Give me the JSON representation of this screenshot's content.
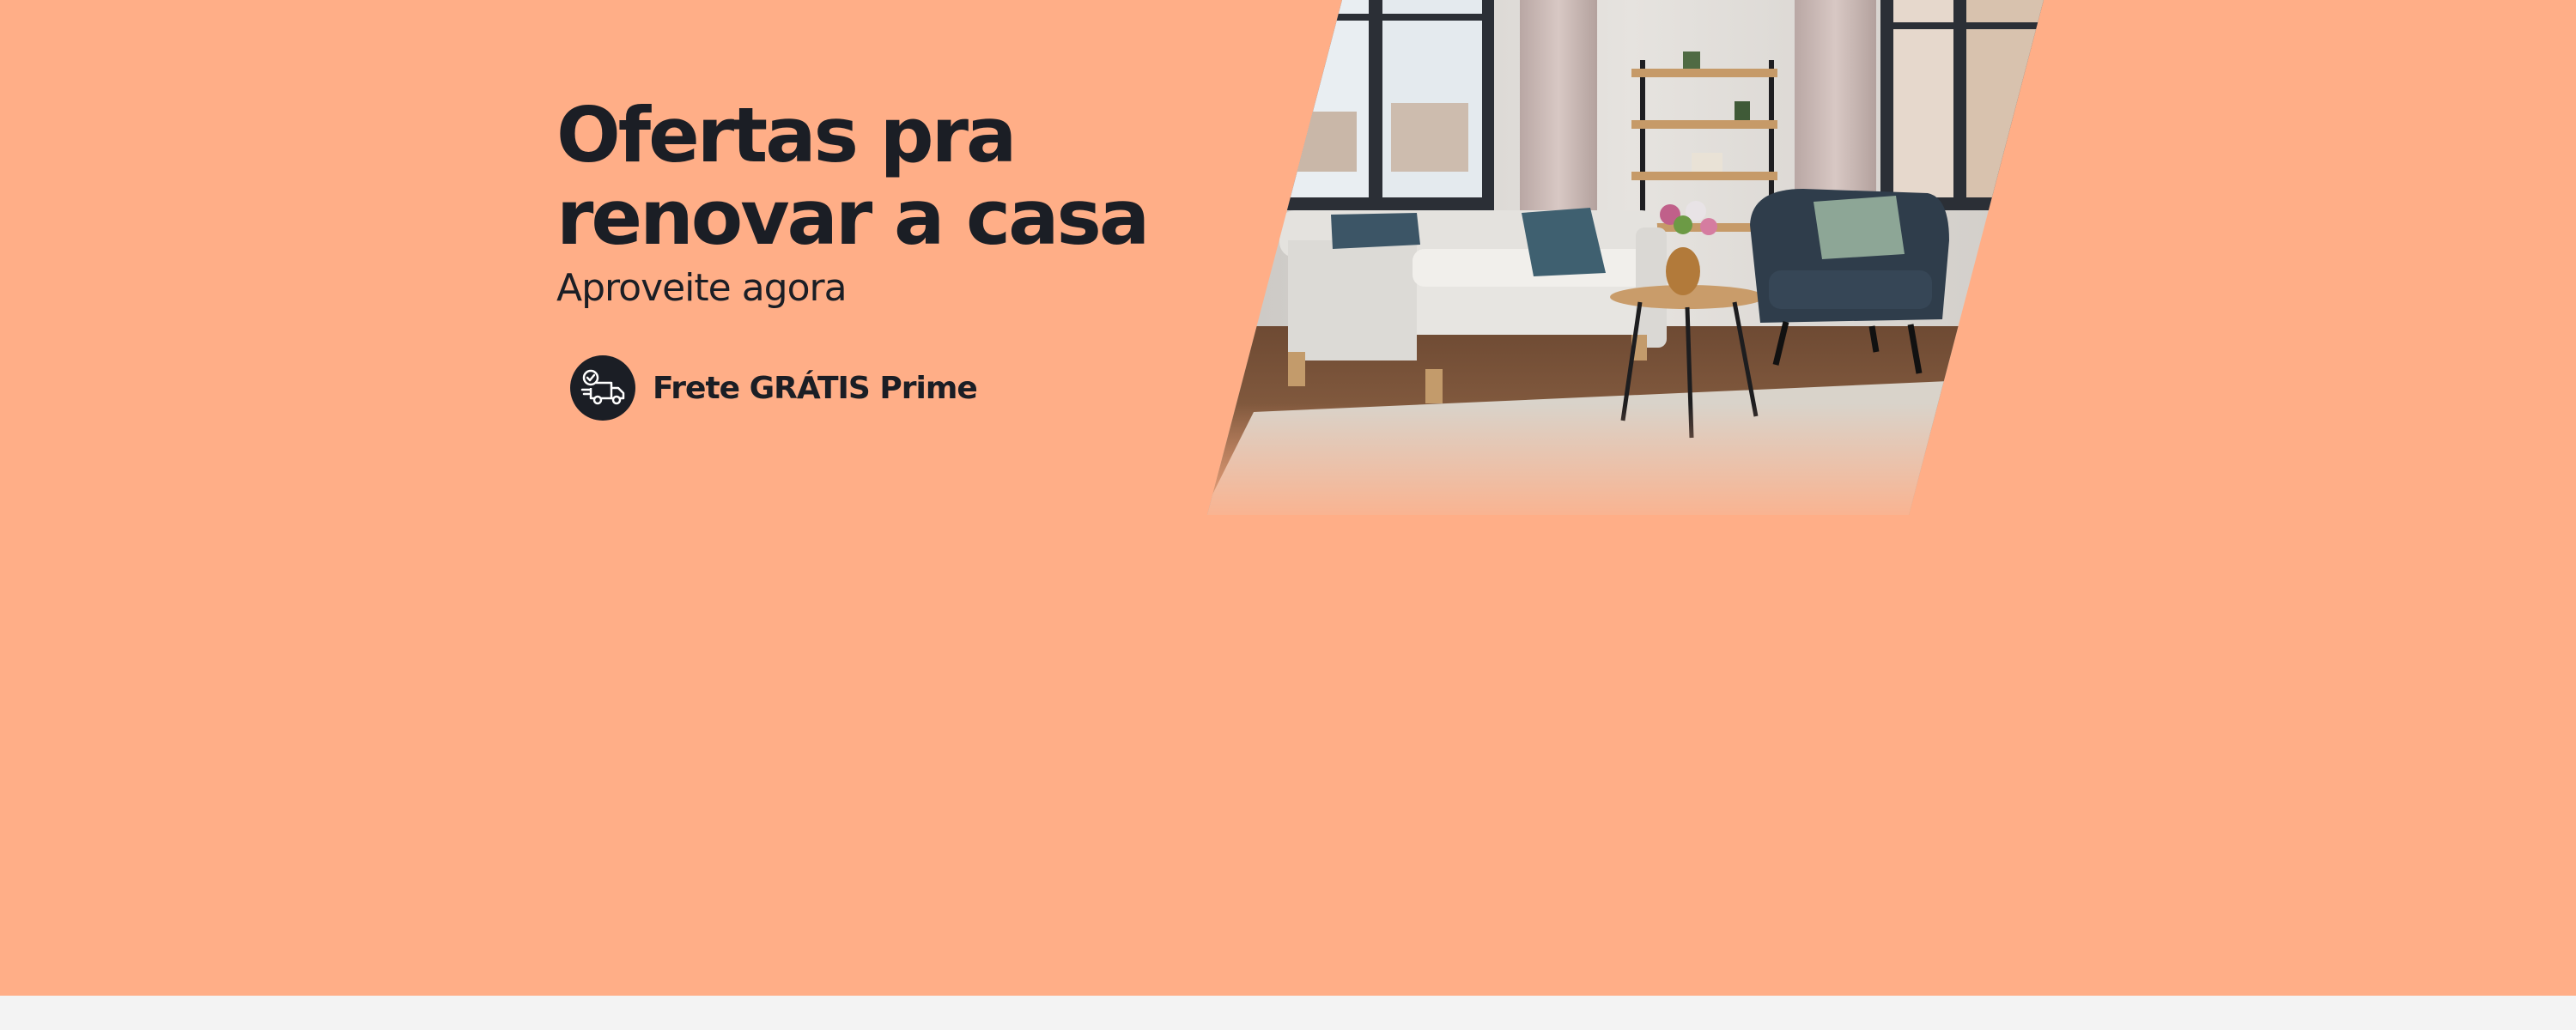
{
  "banner": {
    "headline_line1": "Ofertas pra",
    "headline_line2": "renovar a casa",
    "subheadline": "Aproveite agora",
    "shipping_label": "Frete GRÁTIS Prime",
    "shipping_icon": "delivery-truck-icon",
    "image_subject": "living-room-photo",
    "colors": {
      "background": "#ffae87",
      "text": "#1b1e25",
      "page": "#f3f3f3"
    }
  }
}
